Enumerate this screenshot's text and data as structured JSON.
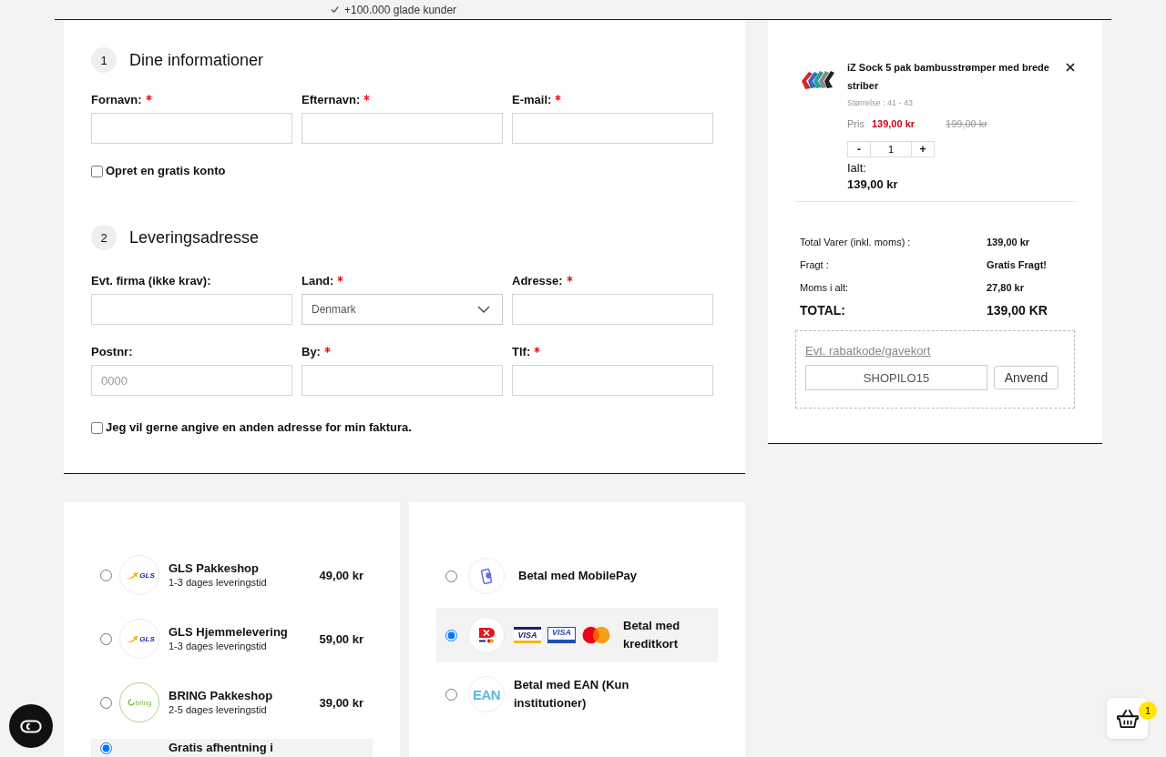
{
  "top_bar": {
    "text": "+100.000 glade kunder"
  },
  "sections": [
    {
      "number": "1",
      "title": "Dine informationer",
      "fields": [
        {
          "kind": "text",
          "label": "Fornavn:",
          "required": true
        },
        {
          "kind": "text",
          "label": "Efternavn:",
          "required": true
        },
        {
          "kind": "text",
          "label": "E-mail:",
          "required": true
        }
      ],
      "checkbox": {
        "label": "Opret en gratis konto",
        "checked": false
      }
    },
    {
      "number": "2",
      "title": "Leveringsadresse",
      "fields": [
        {
          "kind": "text",
          "label": "Evt. firma (ikke krav):",
          "required": false
        },
        {
          "kind": "select",
          "label": "Land:",
          "required": true,
          "value": "Denmark"
        },
        {
          "kind": "text",
          "label": "Adresse:",
          "required": true
        },
        {
          "kind": "text",
          "label": "Postnr:",
          "required": false,
          "placeholder": "0000"
        },
        {
          "kind": "text",
          "label": "By:",
          "required": true
        },
        {
          "kind": "text",
          "label": "Tlf:",
          "required": true
        }
      ],
      "checkbox": {
        "label": "Jeg vil gerne angive en anden adresse for min faktura.",
        "checked": false
      }
    }
  ],
  "shipping": {
    "options": [
      {
        "kind": "gls",
        "logo_text": "GLS",
        "name": "GLS Pakkeshop",
        "delivery": "1-3 dages leveringstid",
        "price": "49,00 kr",
        "selected": false
      },
      {
        "kind": "gls",
        "logo_text": "GLS",
        "name": "GLS Hjemmelevering",
        "delivery": "1-3 dages leveringstid",
        "price": "59,00 kr",
        "selected": false
      },
      {
        "kind": "bring",
        "logo_text": "bring",
        "name": "BRING Pakkeshop",
        "delivery": "2-5 dages leveringstid",
        "price": "39,00 kr",
        "selected": false
      },
      {
        "kind": "plain",
        "name": "Gratis afhentning i",
        "selected": true
      }
    ]
  },
  "payment": {
    "options": [
      {
        "kind": "mobilepay",
        "label": "Betal med MobilePay",
        "selected": false
      },
      {
        "kind": "cards",
        "label": "Betal med kreditkort",
        "selected": true,
        "card_logos": [
          {
            "kind": "visa",
            "text": "VISA"
          },
          {
            "kind": "electron",
            "text": "VISA"
          },
          {
            "kind": "mastercard"
          }
        ]
      },
      {
        "kind": "ean",
        "logo_text": "EAN",
        "label": "Betal med EAN (Kun institutioner)",
        "selected": false
      }
    ]
  },
  "cart": {
    "item": {
      "title": "iZ Sock 5 pak bambusstrømper med brede striber",
      "size": "Størrelse : 41 - 43",
      "price_label": "Pris",
      "price": "139,00 kr",
      "old_price": "199,00 kr",
      "decrement": "-",
      "quantity": "1",
      "increment": "+",
      "total_label": "Ialt:",
      "total": "139,00 kr"
    },
    "summary": [
      {
        "kind": "line",
        "label": "Total Varer (inkl. moms) :",
        "value": "139,00 kr"
      },
      {
        "kind": "line",
        "label": "Fragt :",
        "value": "Gratis Fragt!"
      },
      {
        "kind": "line",
        "label": "Moms i alt:",
        "value": "27,80 kr"
      },
      {
        "kind": "total",
        "label": "TOTAL:",
        "value": "139,00 KR"
      }
    ],
    "discount": {
      "link": "Evt. rabatkode/gavekort",
      "value": "SHOPILO15",
      "button": "Anvend"
    }
  },
  "cart_button": {
    "count": "1"
  }
}
